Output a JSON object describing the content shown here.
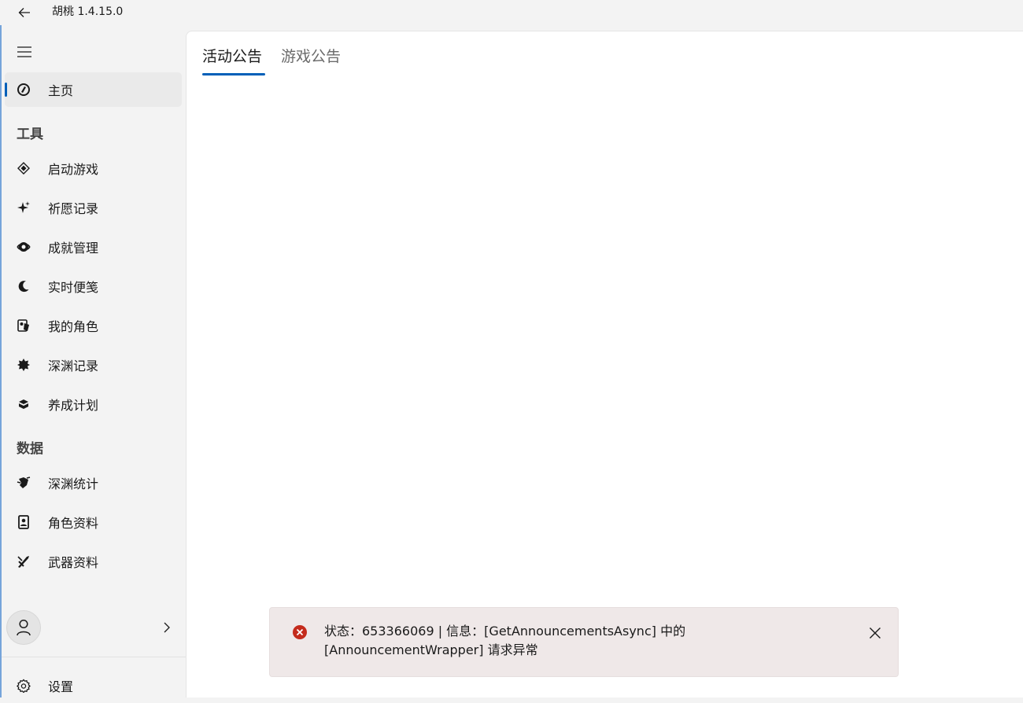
{
  "window": {
    "title": "胡桃 1.4.15.0"
  },
  "sidebar": {
    "home_label": "主页",
    "sections": [
      {
        "label": "工具"
      },
      {
        "label": "数据"
      }
    ],
    "tools": [
      {
        "label": "启动游戏",
        "icon": "launch-game-icon"
      },
      {
        "label": "祈愿记录",
        "icon": "sparkle-icon"
      },
      {
        "label": "成就管理",
        "icon": "achievement-icon"
      },
      {
        "label": "实时便笺",
        "icon": "moon-icon"
      },
      {
        "label": "我的角色",
        "icon": "character-icon"
      },
      {
        "label": "深渊记录",
        "icon": "abyss-icon"
      },
      {
        "label": "养成计划",
        "icon": "cultivation-icon"
      }
    ],
    "data_items": [
      {
        "label": "深渊统计",
        "icon": "abyss-stats-icon"
      },
      {
        "label": "角色资料",
        "icon": "character-wiki-icon"
      },
      {
        "label": "武器资料",
        "icon": "weapon-wiki-icon"
      }
    ],
    "settings_label": "设置"
  },
  "tabs": [
    {
      "label": "活动公告",
      "active": true
    },
    {
      "label": "游戏公告",
      "active": false
    }
  ],
  "infobar": {
    "severity": "error",
    "line1": "状态：653366069 | 信息：[GetAnnouncementsAsync] 中的",
    "line2": "[AnnouncementWrapper] 请求异常"
  },
  "colors": {
    "accent": "#005fb8",
    "error": "#c42b1c",
    "infobar_bg": "#efe8e8"
  }
}
